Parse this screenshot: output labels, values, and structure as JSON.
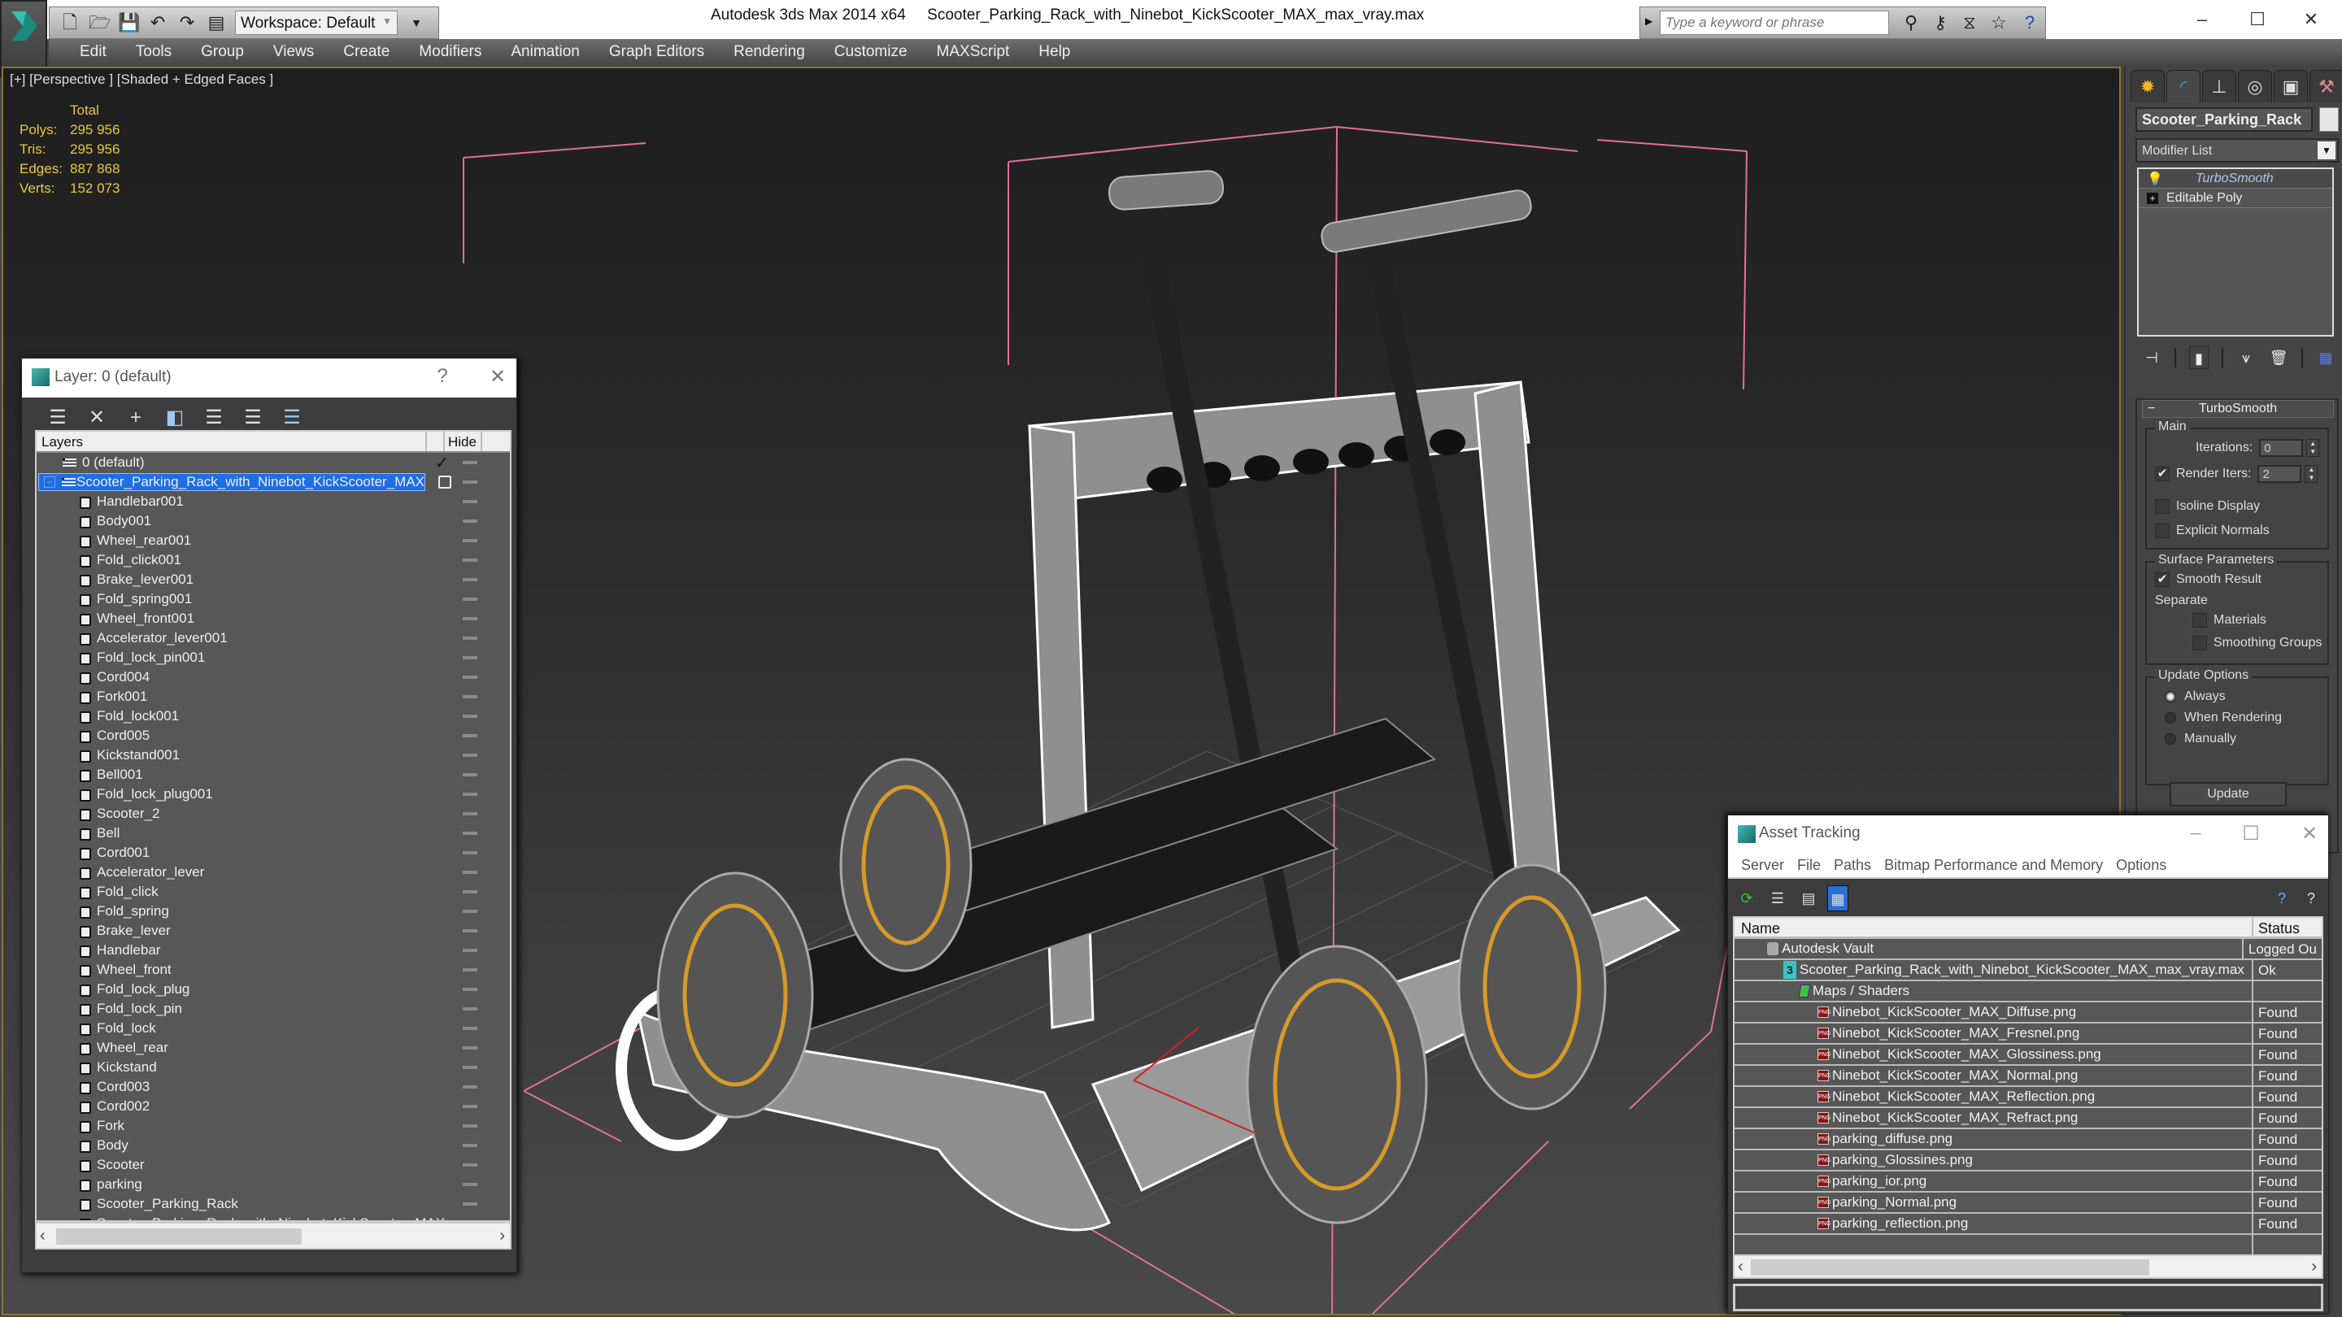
{
  "app": {
    "title": "Autodesk 3ds Max 2014 x64",
    "file_name": "Scooter_Parking_Rack_with_Ninebot_KickScooter_MAX_max_vray.max",
    "workspace": "Workspace: Default",
    "search_placeholder": "Type a keyword or phrase",
    "quick_access_icons": [
      "new-file-icon",
      "open-folder-icon",
      "save-icon",
      "undo-icon",
      "redo-icon",
      "project-folder-icon"
    ],
    "search_tools": [
      "binoculars-icon",
      "key-icon",
      "satellite-icon",
      "star-icon",
      "help-icon"
    ],
    "window_controls": [
      "minimize",
      "maximize",
      "close"
    ]
  },
  "menu": [
    "Edit",
    "Tools",
    "Group",
    "Views",
    "Create",
    "Modifiers",
    "Animation",
    "Graph Editors",
    "Rendering",
    "Customize",
    "MAXScript",
    "Help"
  ],
  "viewport": {
    "label": "[+] [Perspective ] [Shaded + Edged Faces ]",
    "stats": {
      "header": "Total",
      "rows": [
        {
          "label": "Polys:",
          "value": "295 956"
        },
        {
          "label": "Tris:",
          "value": "295 956"
        },
        {
          "label": "Edges:",
          "value": "887 868"
        },
        {
          "label": "Verts:",
          "value": "152 073"
        }
      ]
    },
    "accent_color": "#e6c93a",
    "bbox_color": "#e0709a"
  },
  "layer_dialog": {
    "title": "Layer: 0 (default)",
    "help": "?",
    "toolbar": [
      "create-layer-icon",
      "delete-icon",
      "add-to-layer-icon",
      "select-objects-icon",
      "select-layer-icon",
      "highlight-layer-icon",
      "hide-freeze-icon"
    ],
    "columns": {
      "layers": "Layers",
      "hide": "Hide"
    },
    "layers": [
      {
        "name": "0 (default)",
        "current": true
      },
      {
        "name": "Scooter_Parking_Rack_with_Ninebot_KickScooter_MAX",
        "selected": true,
        "expanded": true
      }
    ],
    "objects": [
      "Handlebar001",
      "Body001",
      "Wheel_rear001",
      "Fold_click001",
      "Brake_lever001",
      "Fold_spring001",
      "Wheel_front001",
      "Accelerator_lever001",
      "Fold_lock_pin001",
      "Cord004",
      "Fork001",
      "Fold_lock001",
      "Cord005",
      "Kickstand001",
      "Bell001",
      "Fold_lock_plug001",
      "Scooter_2",
      "Bell",
      "Cord001",
      "Accelerator_lever",
      "Fold_click",
      "Fold_spring",
      "Brake_lever",
      "Handlebar",
      "Wheel_front",
      "Fold_lock_plug",
      "Fold_lock_pin",
      "Fold_lock",
      "Wheel_rear",
      "Kickstand",
      "Cord003",
      "Cord002",
      "Fork",
      "Body",
      "Scooter",
      "parking",
      "Scooter_Parking_Rack",
      "Scooter_Parking_Rack_with_Ninebot_KickScooter_MAX"
    ]
  },
  "command_panel": {
    "tabs": [
      "create-icon",
      "modify-icon",
      "hierarchy-icon",
      "motion-icon",
      "display-icon",
      "utilities-icon"
    ],
    "active_tab": 1,
    "object_name": "Scooter_Parking_Rack",
    "modifier_list": "Modifier List",
    "stack": [
      {
        "name": "TurboSmooth",
        "active": true
      },
      {
        "name": "Editable Poly",
        "active": false
      }
    ],
    "stack_tools": [
      "pin-stack-icon",
      "show-end-result-icon",
      "make-unique-icon",
      "remove-modifier-icon",
      "configure-sets-icon"
    ],
    "rollout": {
      "title": "TurboSmooth",
      "main": {
        "label": "Main",
        "iterations_label": "Iterations:",
        "iterations": "0",
        "render_iters_label": "Render Iters:",
        "render_iters": "2",
        "render_iters_checked": true,
        "isoline_label": "Isoline Display",
        "isoline_checked": false,
        "explicit_normals_label": "Explicit Normals",
        "explicit_normals_checked": false
      },
      "surface": {
        "label": "Surface Parameters",
        "smooth_result_label": "Smooth Result",
        "smooth_result_checked": true,
        "separate_label": "Separate",
        "materials_label": "Materials",
        "materials_checked": false,
        "smoothing_groups_label": "Smoothing Groups",
        "smoothing_groups_checked": false
      },
      "update": {
        "label": "Update Options",
        "options": [
          "Always",
          "When Rendering",
          "Manually"
        ],
        "selected": "Always",
        "button": "Update"
      }
    }
  },
  "asset_tracking": {
    "title": "Asset Tracking",
    "menu": [
      "Server",
      "File",
      "Paths",
      "Bitmap Performance and Memory",
      "Options"
    ],
    "columns": {
      "name": "Name",
      "status": "Status"
    },
    "rows": [
      {
        "name": "Autodesk Vault",
        "status": "Logged Ou",
        "icon": "vault",
        "indent": 0
      },
      {
        "name": "Scooter_Parking_Rack_with_Ninebot_KickScooter_MAX_max_vray.max",
        "status": "Ok",
        "icon": "max",
        "indent": 1
      },
      {
        "name": "Maps / Shaders",
        "status": "",
        "icon": "maps",
        "indent": 2
      },
      {
        "name": "Ninebot_KickScooter_MAX_Diffuse.png",
        "status": "Found",
        "icon": "png",
        "indent": 3
      },
      {
        "name": "Ninebot_KickScooter_MAX_Fresnel.png",
        "status": "Found",
        "icon": "png",
        "indent": 3
      },
      {
        "name": "Ninebot_KickScooter_MAX_Glossiness.png",
        "status": "Found",
        "icon": "png",
        "indent": 3
      },
      {
        "name": "Ninebot_KickScooter_MAX_Normal.png",
        "status": "Found",
        "icon": "png",
        "indent": 3
      },
      {
        "name": "Ninebot_KickScooter_MAX_Reflection.png",
        "status": "Found",
        "icon": "png",
        "indent": 3
      },
      {
        "name": "Ninebot_KickScooter_MAX_Refract.png",
        "status": "Found",
        "icon": "png",
        "indent": 3
      },
      {
        "name": "parking_diffuse.png",
        "status": "Found",
        "icon": "png",
        "indent": 3
      },
      {
        "name": "parking_Glossines.png",
        "status": "Found",
        "icon": "png",
        "indent": 3
      },
      {
        "name": "parking_ior.png",
        "status": "Found",
        "icon": "png",
        "indent": 3
      },
      {
        "name": "parking_Normal.png",
        "status": "Found",
        "icon": "png",
        "indent": 3
      },
      {
        "name": "parking_reflection.png",
        "status": "Found",
        "icon": "png",
        "indent": 3
      }
    ]
  }
}
